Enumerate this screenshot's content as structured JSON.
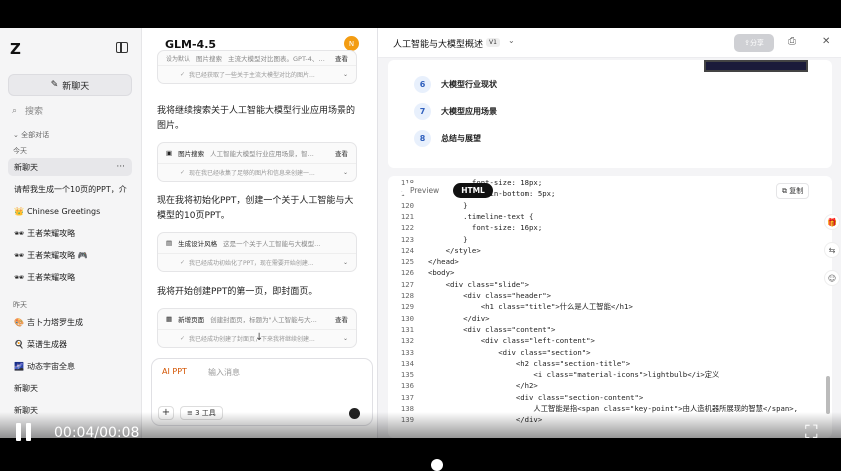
{
  "sidebar": {
    "logo": "Z",
    "new_chat": "新聊天",
    "search_placeholder": "搜索",
    "all_chats": "全部对话",
    "today_label": "今天",
    "yesterday_label": "昨天",
    "today_items": [
      {
        "icon": "",
        "label": "新聊天"
      },
      {
        "icon": "",
        "label": "请帮我生成一个10页的PPT，介"
      },
      {
        "icon": "👑",
        "label": "Chinese Greetings"
      },
      {
        "icon": "🕶",
        "label": "王者荣耀攻略"
      },
      {
        "icon": "🕶",
        "label": "王者荣耀攻略 🎮"
      },
      {
        "icon": "🕶",
        "label": "王者荣耀攻略"
      }
    ],
    "yesterday_items": [
      {
        "icon": "🎨",
        "label": "吉卜力塔罗生成"
      },
      {
        "icon": "🍳",
        "label": "菜谱生成器"
      },
      {
        "icon": "🌌",
        "label": "动态宇宙全息"
      },
      {
        "icon": "",
        "label": "新聊天"
      },
      {
        "icon": "",
        "label": "新聊天"
      }
    ],
    "more_icon": "···"
  },
  "chat": {
    "model": "GLM-4.5",
    "set_default": "设为默认",
    "avatar_letter": "N",
    "card0": {
      "name": "图片搜索",
      "desc": "主流大模型对比图表。GPT-4、Cl...",
      "view": "查看",
      "status": "我已经获取了一些关于主流大模型对比的图片..."
    },
    "text1": "我将继续搜索关于人工智能大模型行业应用场景的图片。",
    "card1": {
      "name": "图片搜索",
      "desc": "人工智能大模型行业应用场景，智...",
      "view": "查看",
      "status": "现在我已经收集了足够的图片和信息来创建一..."
    },
    "text2": "现在我将初始化PPT，创建一个关于人工智能与大模型的10页PPT。",
    "card2": {
      "name": "生成设计风格",
      "desc": "这是一个关于人工智能与大模型...",
      "status": "我已经成功初始化了PPT，现在需要开始创建..."
    },
    "text3": "我将开始创建PPT的第一页，即封面页。",
    "card3": {
      "name": "新增页面",
      "desc": "创建封面页，标题为\"人工智能与大...",
      "view": "查看",
      "status": "我已经成功创建了封面页，下来我将继续创建..."
    },
    "ai_ppt": "AI PPT",
    "input_placeholder": "输入消息",
    "tools_label": "3 工具"
  },
  "panel": {
    "title": "人工智能与大模型概述",
    "version": "V1",
    "share": "分享",
    "agenda": [
      {
        "num": "6",
        "label": "大模型行业现状"
      },
      {
        "num": "7",
        "label": "大模型应用场景"
      },
      {
        "num": "8",
        "label": "总结与展望"
      }
    ],
    "tab_preview": "Preview",
    "tab_html": "HTML",
    "copy": "复制",
    "code_lines": [
      {
        "n": "118",
        "t": "          font-size: 18px;"
      },
      {
        "n": "119",
        "t": "          margin-bottom: 5px;"
      },
      {
        "n": "120",
        "t": "        }"
      },
      {
        "n": "121",
        "t": "        .timeline-text {"
      },
      {
        "n": "122",
        "t": "          font-size: 16px;"
      },
      {
        "n": "123",
        "t": "        }"
      },
      {
        "n": "124",
        "t": "    </style>"
      },
      {
        "n": "125",
        "t": "</head>"
      },
      {
        "n": "126",
        "t": "<body>"
      },
      {
        "n": "127",
        "t": "    <div class=\"slide\">"
      },
      {
        "n": "128",
        "t": "        <div class=\"header\">"
      },
      {
        "n": "129",
        "t": "            <h1 class=\"title\">什么是人工智能</h1>"
      },
      {
        "n": "130",
        "t": "        </div>"
      },
      {
        "n": "131",
        "t": "        <div class=\"content\">"
      },
      {
        "n": "132",
        "t": "            <div class=\"left-content\">"
      },
      {
        "n": "133",
        "t": "                <div class=\"section\">"
      },
      {
        "n": "134",
        "t": "                    <h2 class=\"section-title\">"
      },
      {
        "n": "135",
        "t": "                        <i class=\"material-icons\">lightbulb</i>定义"
      },
      {
        "n": "136",
        "t": "                    </h2>"
      },
      {
        "n": "137",
        "t": "                    <div class=\"section-content\">"
      },
      {
        "n": "138",
        "t": "                        人工智能是指<span class=\"key-point\">由人造机器所展现的智慧</span>,"
      },
      {
        "n": "139",
        "t": "                    </div>"
      }
    ]
  },
  "video": {
    "timecode": "00:04/00:08",
    "progress": 0.5
  }
}
